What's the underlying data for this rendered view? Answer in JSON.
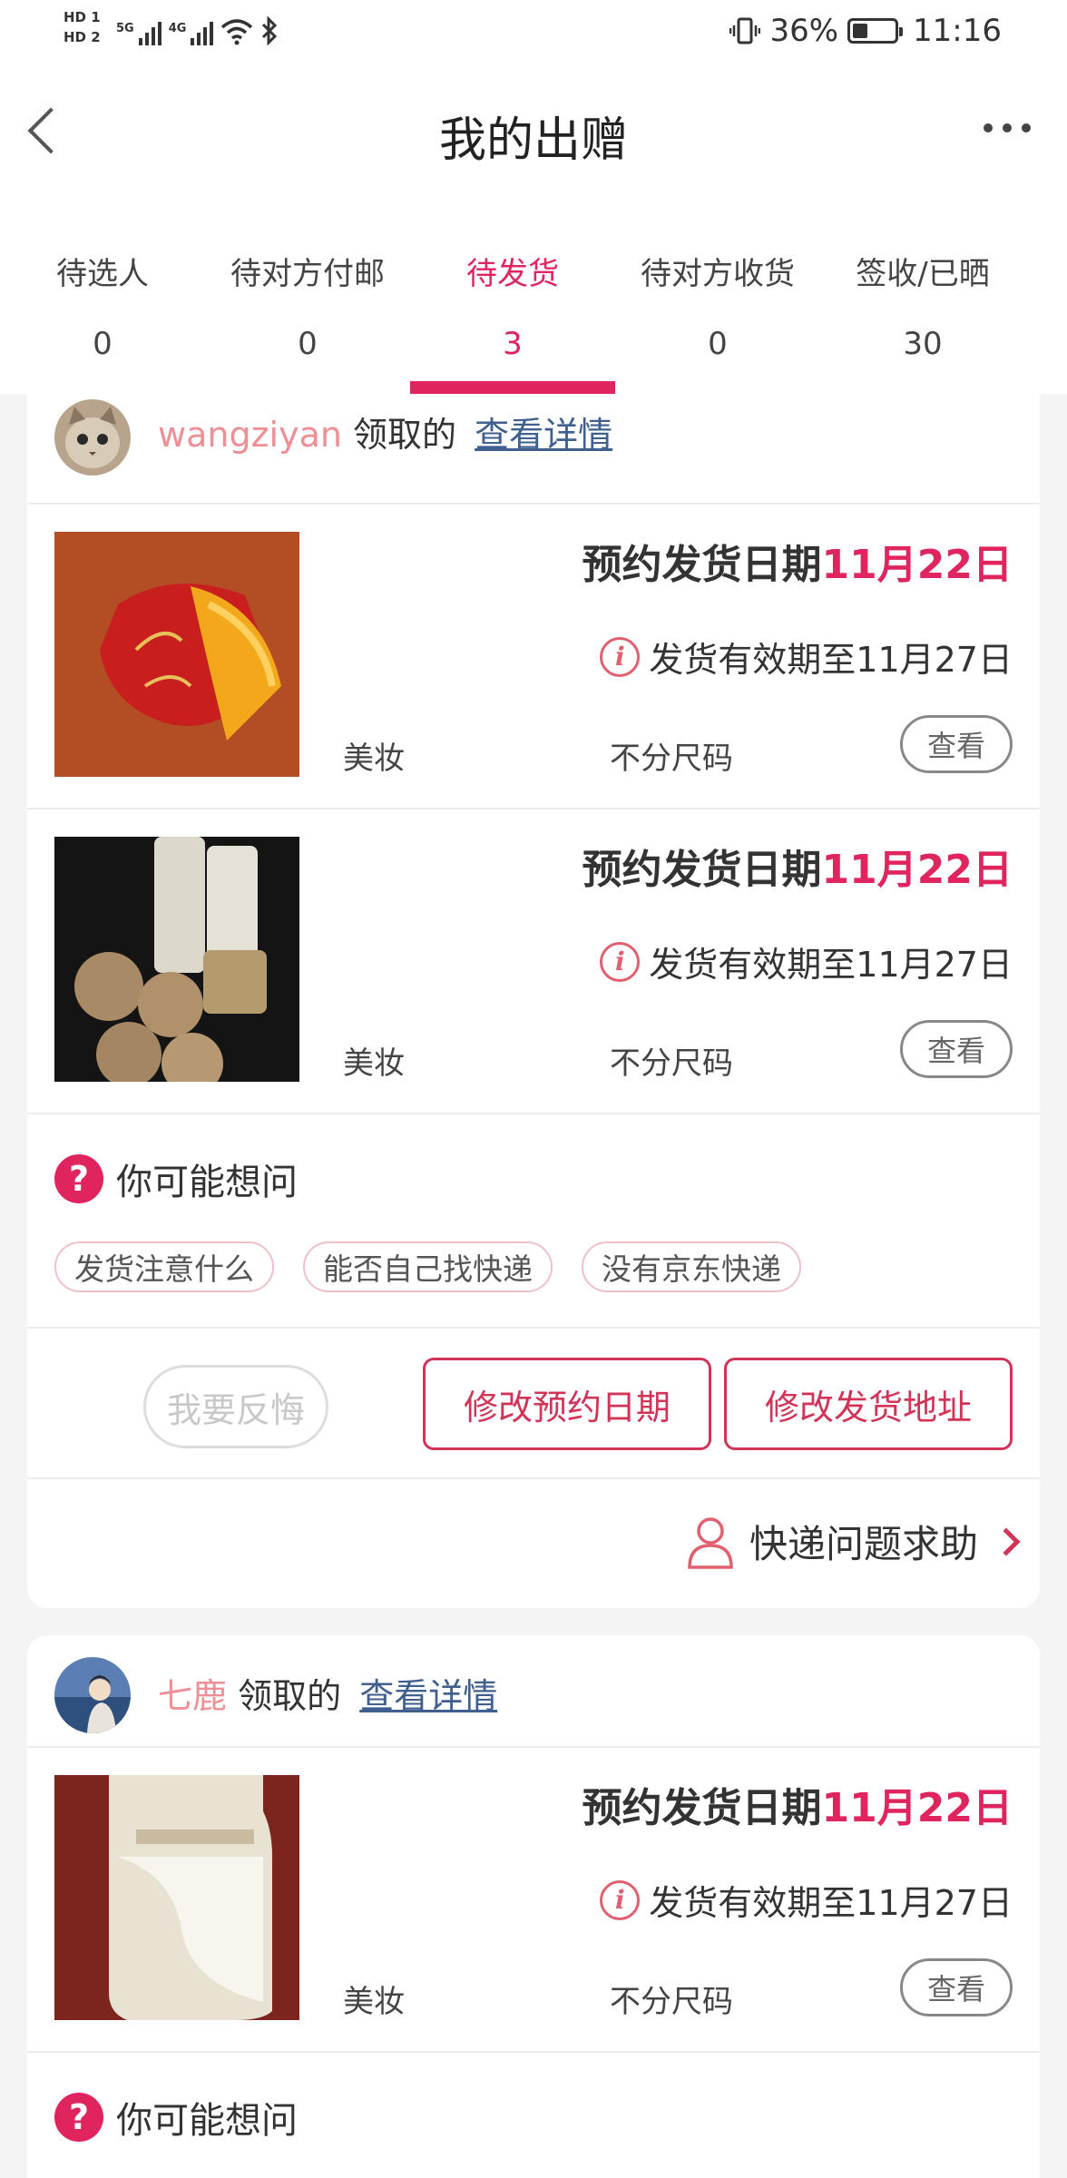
{
  "status_bar": {
    "hd1": "HD 1",
    "hd2": "HD 2",
    "net1": "5G",
    "net2": "4G",
    "battery": "36%",
    "time": "11:16",
    "icons": [
      "signal-icon",
      "wifi-icon",
      "bluetooth-icon",
      "vibrate-icon",
      "battery-icon"
    ]
  },
  "nav": {
    "title": "我的出赠",
    "icons": [
      "back-icon",
      "more-icon"
    ]
  },
  "tabs": [
    {
      "label": "待选人",
      "count": "0"
    },
    {
      "label": "待对方付邮",
      "count": "0"
    },
    {
      "label": "待发货",
      "count": "3"
    },
    {
      "label": "待对方收货",
      "count": "0"
    },
    {
      "label": "签收/已晒",
      "count": "30"
    }
  ],
  "active_tab": 2,
  "orders": [
    {
      "user": "wangziyan",
      "received": "领取的",
      "detail_link": "查看详情",
      "items": [
        {
          "date_label": "预约发货日期",
          "date": "11月22日",
          "valid": "发货有效期至11月27日",
          "category": "美妆",
          "size": "不分尺码",
          "view": "查看"
        },
        {
          "date_label": "预约发货日期",
          "date": "11月22日",
          "valid": "发货有效期至11月27日",
          "category": "美妆",
          "size": "不分尺码",
          "view": "查看"
        }
      ],
      "faq": {
        "title": "你可能想问",
        "chips": [
          "发货注意什么",
          "能否自己找快递",
          "没有京东快递"
        ]
      },
      "actions": {
        "regret": "我要反悔",
        "change_date": "修改预约日期",
        "change_address": "修改发货地址"
      },
      "help": "快递问题求助"
    },
    {
      "user": "七鹿",
      "received": "领取的",
      "detail_link": "查看详情",
      "items": [
        {
          "date_label": "预约发货日期",
          "date": "11月22日",
          "valid": "发货有效期至11月27日",
          "category": "美妆",
          "size": "不分尺码",
          "view": "查看"
        }
      ],
      "faq": {
        "title": "你可能想问"
      }
    }
  ],
  "colors": {
    "accent": "#e0245e",
    "user_name": "#f08e95",
    "link": "#3f5f8e",
    "button_border": "#d23458"
  }
}
